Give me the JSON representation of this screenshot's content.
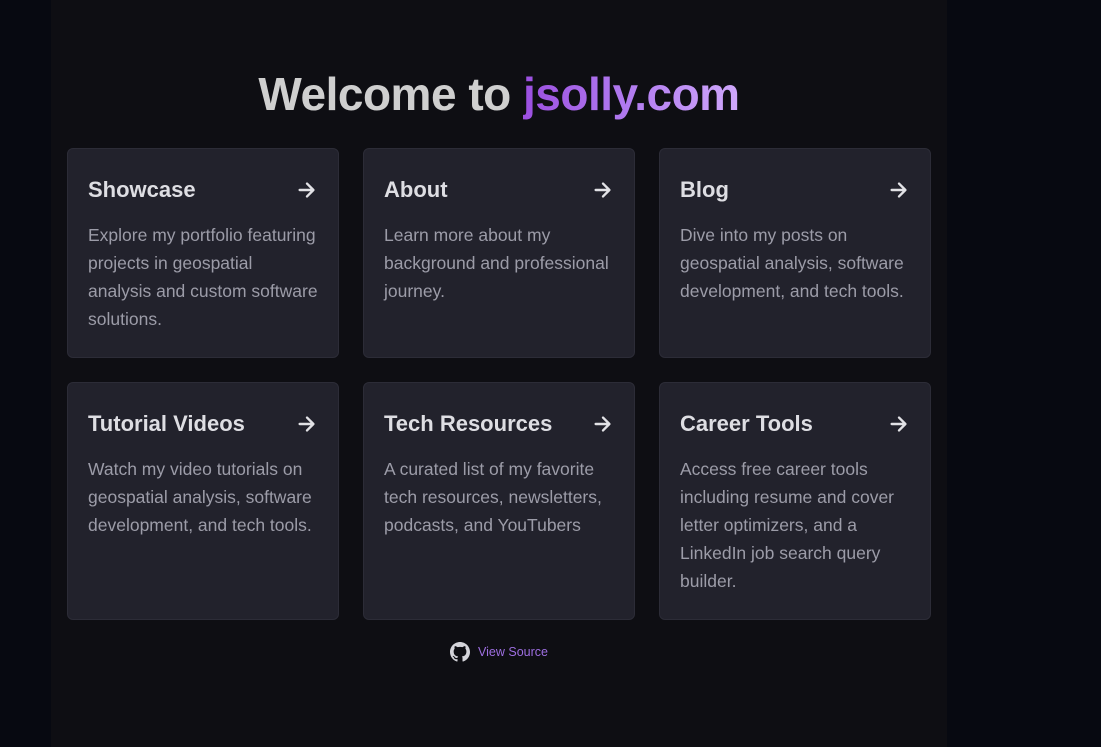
{
  "hero": {
    "prefix": "Welcome to ",
    "brand": "jsolly.com"
  },
  "cards": [
    {
      "title": "Showcase",
      "description": "Explore my portfolio featuring projects in geospatial analysis and custom software solutions."
    },
    {
      "title": "About",
      "description": "Learn more about my background and professional journey."
    },
    {
      "title": "Blog",
      "description": "Dive into my posts on geospatial analysis, software development, and tech tools."
    },
    {
      "title": "Tutorial Videos",
      "description": "Watch my video tutorials on geospatial analysis, software development, and tech tools."
    },
    {
      "title": "Tech Resources",
      "description": "A curated list of my favorite tech resources, newsletters, podcasts, and YouTubers"
    },
    {
      "title": "Career Tools",
      "description": "Access free career tools including resume and cover letter optimizers, and a LinkedIn job search query builder."
    }
  ],
  "footer": {
    "source_label": "View Source",
    "icon": "github-icon"
  },
  "colors": {
    "page_bg": "#070911",
    "panel_bg": "#0e0e13",
    "card_bg": "#22222c",
    "brand_gradient_start": "#9b4fe0",
    "brand_gradient_end": "#cfa8fb",
    "link": "#9d6ee0"
  }
}
